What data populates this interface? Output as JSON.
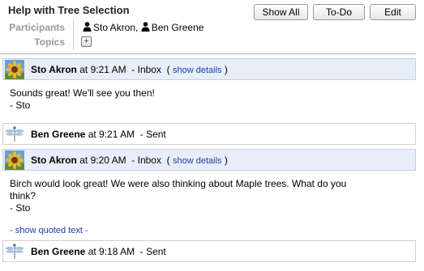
{
  "header": {
    "title": "Help with Tree Selection",
    "buttons": {
      "show_all": "Show All",
      "todo": "To-Do",
      "edit": "Edit"
    }
  },
  "meta": {
    "participants_label": "Participants",
    "topics_label": "Topics",
    "participants": [
      "Sto Akron",
      "Ben Greene"
    ],
    "separator": ",",
    "add_topic_symbol": "+"
  },
  "messages": [
    {
      "sender": "Sto Akron",
      "time": "at 9:21 AM",
      "folder": "-  Inbox",
      "details_open": "(",
      "details_link": "show details",
      "details_close": ")",
      "body_lines": [
        "Sounds great!  We'll see you then!",
        "- Sto"
      ]
    },
    {
      "sender": "Ben Greene",
      "time": "at 9:21 AM",
      "folder": "-  Sent"
    },
    {
      "sender": "Sto Akron",
      "time": "at 9:20 AM",
      "folder": "-  Inbox",
      "details_open": "(",
      "details_link": "show details",
      "details_close": ")",
      "body_lines": [
        "Birch would look great!  We were also thinking about Maple trees.  What do you",
        "think?",
        "- Sto"
      ],
      "quoted_link": "- show quoted text -"
    },
    {
      "sender": "Ben Greene",
      "time": "at 9:18 AM",
      "folder": "-  Sent"
    }
  ],
  "colors": {
    "accent_link": "#1a3fa8",
    "header_bg": "#e8eef7"
  }
}
